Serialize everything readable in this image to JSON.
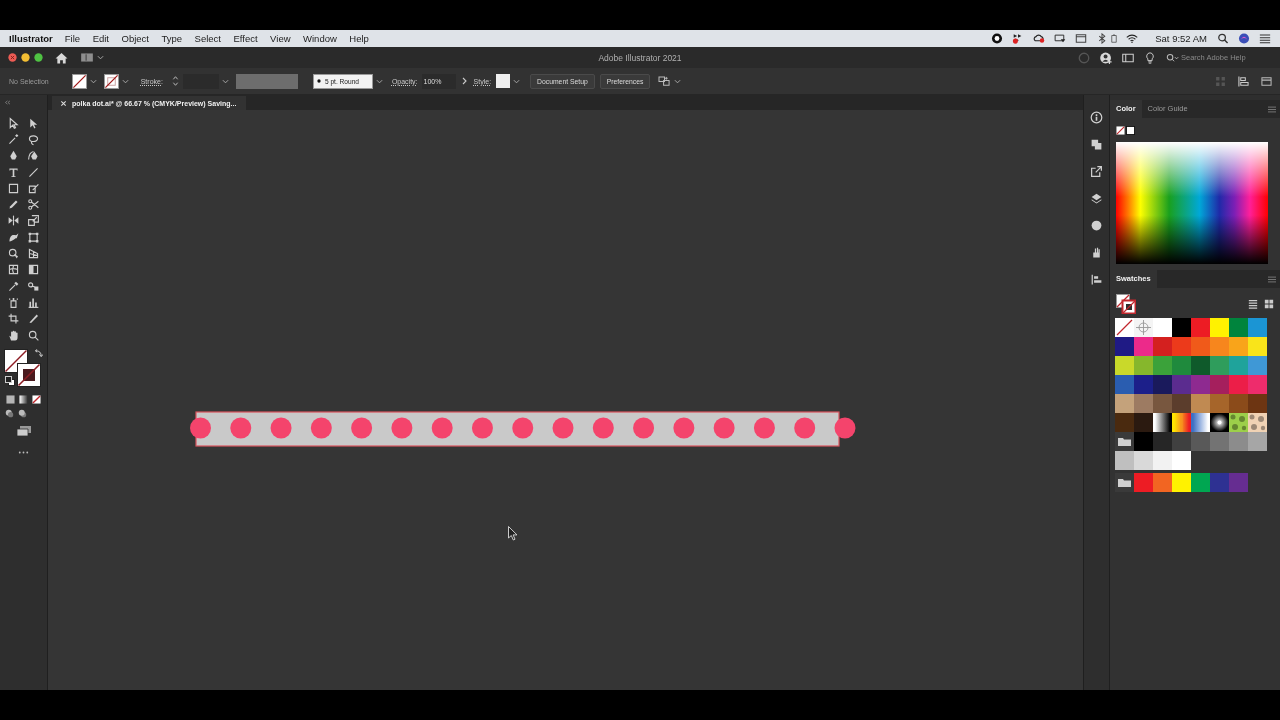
{
  "menu_bar": {
    "app_name": "Illustrator",
    "menus": [
      "File",
      "Edit",
      "Object",
      "Type",
      "Select",
      "Effect",
      "View",
      "Window",
      "Help"
    ],
    "clock": "Sat 9:52 AM"
  },
  "app_bar": {
    "title": "Adobe Illustrator 2021",
    "search": {
      "placeholder": "Search Adobe Help"
    }
  },
  "control_bar": {
    "selection": "No Selection",
    "stroke_label": "Stroke:",
    "brush": "5 pt. Round",
    "opacity_label": "Opacity:",
    "opacity": "100%",
    "style_label": "Style:",
    "buttons": [
      "Document Setup",
      "Preferences"
    ]
  },
  "document_tab": {
    "title": "polka dot.ai* @ 66.67 % (CMYK/Preview) Saving..."
  },
  "color_panel": {
    "tabs": [
      {
        "label": "Color",
        "selected": true
      },
      {
        "label": "Color Guide",
        "selected": false
      }
    ]
  },
  "swatches_panel": {
    "title": "Swatches",
    "rows": [
      {
        "swatches": [
          {
            "kind": "none"
          },
          {
            "kind": "registration"
          },
          {
            "kind": "color",
            "color": "#ffffff"
          },
          {
            "kind": "color",
            "color": "#000000"
          },
          {
            "kind": "color",
            "color": "#ed1c24"
          },
          {
            "kind": "color",
            "color": "#fff200"
          },
          {
            "kind": "color",
            "color": "#00843d"
          },
          {
            "kind": "color",
            "color": "#1b95d4"
          }
        ]
      },
      {
        "swatches": [
          {
            "kind": "color",
            "color": "#1f1a85"
          },
          {
            "kind": "color",
            "color": "#ec2a8a"
          },
          {
            "kind": "color",
            "color": "#d4201f"
          },
          {
            "kind": "color",
            "color": "#ec3a1b"
          },
          {
            "kind": "color",
            "color": "#f05a1a"
          },
          {
            "kind": "color",
            "color": "#f7861d"
          },
          {
            "kind": "color",
            "color": "#f9a41a"
          },
          {
            "kind": "color",
            "color": "#f9e41a"
          }
        ]
      },
      {
        "swatches": [
          {
            "kind": "color",
            "color": "#c9d92a"
          },
          {
            "kind": "color",
            "color": "#86b72c"
          },
          {
            "kind": "color",
            "color": "#3ba23a"
          },
          {
            "kind": "color",
            "color": "#1f8a3d"
          },
          {
            "kind": "color",
            "color": "#0f5a2b"
          },
          {
            "kind": "color",
            "color": "#2f9d5c"
          },
          {
            "kind": "color",
            "color": "#1fa39b"
          },
          {
            "kind": "color",
            "color": "#3f98d6"
          }
        ]
      },
      {
        "swatches": [
          {
            "kind": "color",
            "color": "#2a5db0"
          },
          {
            "kind": "color",
            "color": "#1c1f8a"
          },
          {
            "kind": "color",
            "color": "#1a1a5c"
          },
          {
            "kind": "color",
            "color": "#5b2c8f"
          },
          {
            "kind": "color",
            "color": "#8e2a90"
          },
          {
            "kind": "color",
            "color": "#a51f5d"
          },
          {
            "kind": "color",
            "color": "#ec1e48"
          },
          {
            "kind": "color",
            "color": "#ee2c6c"
          }
        ]
      },
      {
        "swatches": [
          {
            "kind": "color",
            "color": "#c4a27b"
          },
          {
            "kind": "color",
            "color": "#9d7b62"
          },
          {
            "kind": "color",
            "color": "#78573f"
          },
          {
            "kind": "color",
            "color": "#5b3d2c"
          },
          {
            "kind": "color",
            "color": "#c08a52"
          },
          {
            "kind": "color",
            "color": "#a6652a"
          },
          {
            "kind": "color",
            "color": "#8b4b1a"
          },
          {
            "kind": "color",
            "color": "#6d3512"
          }
        ]
      },
      {
        "swatches": [
          {
            "kind": "color",
            "color": "#4a2a0f"
          },
          {
            "kind": "color",
            "color": "#2b1a10"
          },
          {
            "kind": "gradient",
            "stops": [
              {
                "color": "#ffffff"
              },
              {
                "color": "#000000"
              }
            ]
          },
          {
            "kind": "gradient",
            "stops": [
              {
                "color": "#ffe600"
              },
              {
                "color": "#f7941d"
              },
              {
                "color": "#ed1c24"
              }
            ]
          },
          {
            "kind": "gradient",
            "stops": [
              {
                "color": "#3d6fc4"
              },
              {
                "color": "#ffffff"
              }
            ]
          },
          {
            "kind": "radial",
            "stops": [
              {
                "color": "#ffffff"
              },
              {
                "color": "#000000"
              }
            ]
          },
          {
            "kind": "pattern",
            "color": "#9ccf4a"
          },
          {
            "kind": "pattern",
            "color": "#f0d2b4"
          }
        ]
      },
      {
        "swatches": [
          {
            "kind": "folder"
          },
          {
            "kind": "color",
            "color": "#000000"
          },
          {
            "kind": "color",
            "color": "#262626"
          },
          {
            "kind": "color",
            "color": "#404040"
          },
          {
            "kind": "color",
            "color": "#595959"
          },
          {
            "kind": "color",
            "color": "#737373"
          },
          {
            "kind": "color",
            "color": "#8c8c8c"
          },
          {
            "kind": "color",
            "color": "#a6a6a6"
          }
        ]
      },
      {
        "swatches": [
          {
            "kind": "color",
            "color": "#bfbfbf"
          },
          {
            "kind": "color",
            "color": "#d9d9d9"
          },
          {
            "kind": "color",
            "color": "#f2f2f2"
          },
          {
            "kind": "color",
            "color": "#ffffff"
          }
        ]
      },
      {
        "swatches": [
          {
            "kind": "folder"
          },
          {
            "kind": "color",
            "color": "#ed1c24"
          },
          {
            "kind": "color",
            "color": "#f26522"
          },
          {
            "kind": "color",
            "color": "#fff200"
          },
          {
            "kind": "color",
            "color": "#00a651"
          },
          {
            "kind": "color",
            "color": "#2e3192"
          },
          {
            "kind": "color",
            "color": "#662d91"
          }
        ]
      }
    ]
  }
}
